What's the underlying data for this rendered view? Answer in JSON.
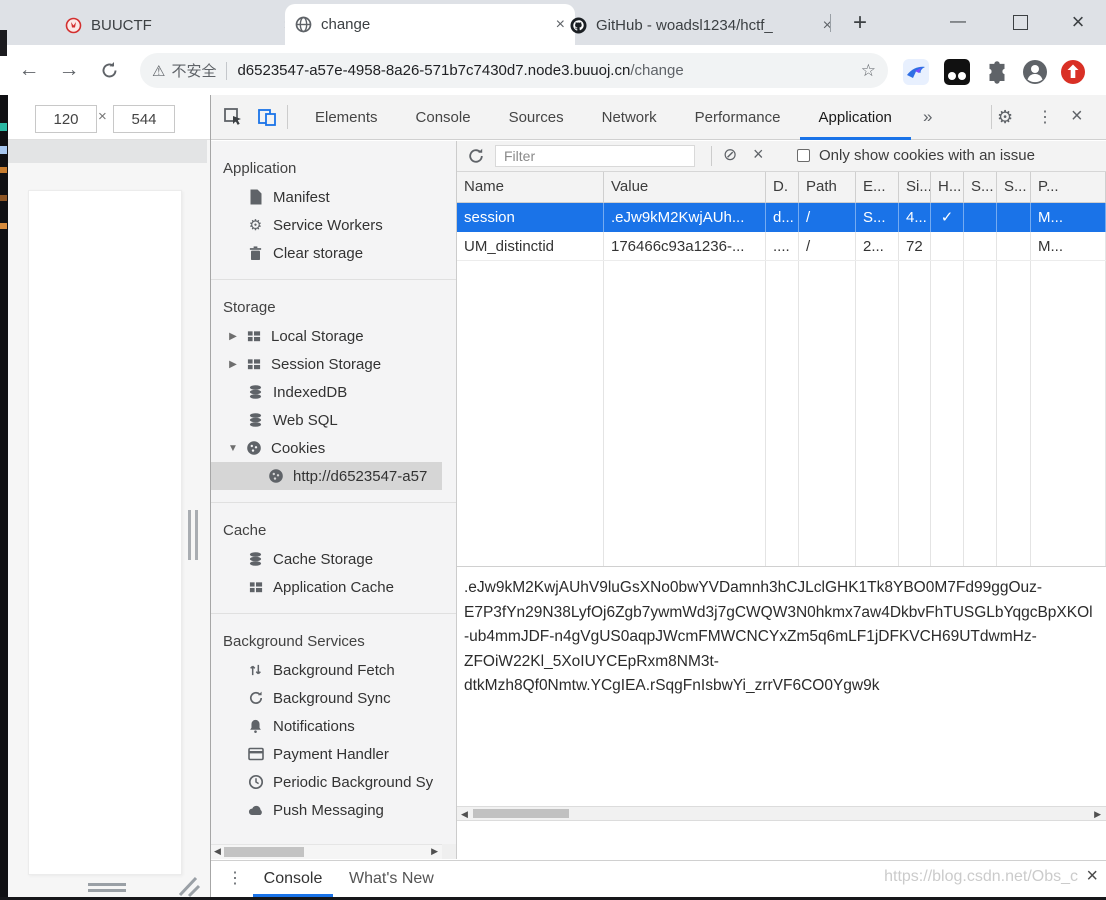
{
  "browser": {
    "tabs": [
      {
        "title": "BUUCTF"
      },
      {
        "title": "change"
      },
      {
        "title": "GitHub - woadsl1234/hctf_"
      }
    ],
    "address_bar": {
      "security_label": "不安全",
      "url_host": "d6523547-a57e-4958-8a26-571b7c7430d7.node3.buuoj.cn",
      "url_path": "/change"
    }
  },
  "device_toolbar": {
    "width": "120",
    "separator": "×",
    "height": "544"
  },
  "devtools": {
    "tabs": [
      {
        "label": "Elements"
      },
      {
        "label": "Console"
      },
      {
        "label": "Sources"
      },
      {
        "label": "Network"
      },
      {
        "label": "Performance"
      },
      {
        "label": "Application"
      }
    ],
    "selected_tab": "Application",
    "sidebar": {
      "sections": [
        {
          "title": "Application",
          "items": [
            {
              "label": "Manifest"
            },
            {
              "label": "Service Workers"
            },
            {
              "label": "Clear storage"
            }
          ]
        },
        {
          "title": "Storage",
          "items": [
            {
              "label": "Local Storage",
              "expander": "▶"
            },
            {
              "label": "Session Storage",
              "expander": "▶"
            },
            {
              "label": "IndexedDB"
            },
            {
              "label": "Web SQL"
            },
            {
              "label": "Cookies",
              "expander": "▼"
            },
            {
              "label": "http://d6523547-a57",
              "selected": true
            }
          ]
        },
        {
          "title": "Cache",
          "items": [
            {
              "label": "Cache Storage"
            },
            {
              "label": "Application Cache"
            }
          ]
        },
        {
          "title": "Background Services",
          "items": [
            {
              "label": "Background Fetch"
            },
            {
              "label": "Background Sync"
            },
            {
              "label": "Notifications"
            },
            {
              "label": "Payment Handler"
            },
            {
              "label": "Periodic Background Sy"
            },
            {
              "label": "Push Messaging"
            }
          ]
        }
      ]
    },
    "cookie_pane": {
      "filter_placeholder": "Filter",
      "issue_filter_label": "Only show cookies with an issue",
      "columns": [
        "Name",
        "Value",
        "D.",
        "Path",
        "E...",
        "Si...",
        "H...",
        "S...",
        "S...",
        "P..."
      ],
      "rows": [
        {
          "name": "session",
          "value": ".eJw9kM2KwjAUh...",
          "domain": "d...",
          "path": "/",
          "expires": "S...",
          "size": "4...",
          "http_only": "✓",
          "secure": "",
          "same_site": "",
          "priority": "M...",
          "selected": true
        },
        {
          "name": "UM_distinctid",
          "value": "176466c93a1236-...",
          "domain": "....",
          "path": "/",
          "expires": "2...",
          "size": "72",
          "http_only": "",
          "secure": "",
          "same_site": "",
          "priority": "M...",
          "selected": false
        }
      ],
      "value_preview_lines": [
        ".eJw9kM2KwjAUhV9luGsXNo0bwYVDamnh3hCJLclGHK1Tk8YBO0M7Fd99ggOuz-",
        "E7P3fYn29N38LyfOj6Zgb7ywmWd3j7gCWQW3N0hkmx7aw4DkbvFhTUSGLbYqgcBpXKOl",
        "-ub4mmJDF-n4gVgUS0aqpJWcmFMWCNCYxZm5q6mLF1jDFKVCH69UTdwmHz-",
        "ZFOiW22Kl_5XoIUYCEpRxm8NM3t-",
        "dtkMzh8Qf0Nmtw.YCgIEA.rSqgFnIsbwYi_zrrVF6CO0Ygw9k"
      ]
    },
    "drawer": {
      "tabs": [
        {
          "label": "Console"
        },
        {
          "label": "What's New"
        }
      ],
      "selected_tab": "Console"
    }
  },
  "watermark": {
    "text": "https://blog.csdn.net/Obs_c"
  },
  "icons": {
    "close": "×",
    "plus": "+",
    "kebab": "⋮",
    "gear": "⚙",
    "star": "☆",
    "warning": "⚠",
    "block": "⊘",
    "back": "←",
    "forward": "→",
    "more_tabs": "»",
    "cloud": "☁",
    "minimize": "—",
    "expand_right": "▶",
    "expand_down": "▼",
    "scroll_up": "▲",
    "scroll_down": "▼",
    "scroll_left": "◀",
    "scroll_right": "▶"
  },
  "colors": {
    "accent_blue": "#1a73e8",
    "selected_row_blue": "#1a73e8",
    "titlebar_grey": "#dee1e6",
    "update_badge_red": "#d93025",
    "buuctf_logo_red": "#d32f2f"
  }
}
